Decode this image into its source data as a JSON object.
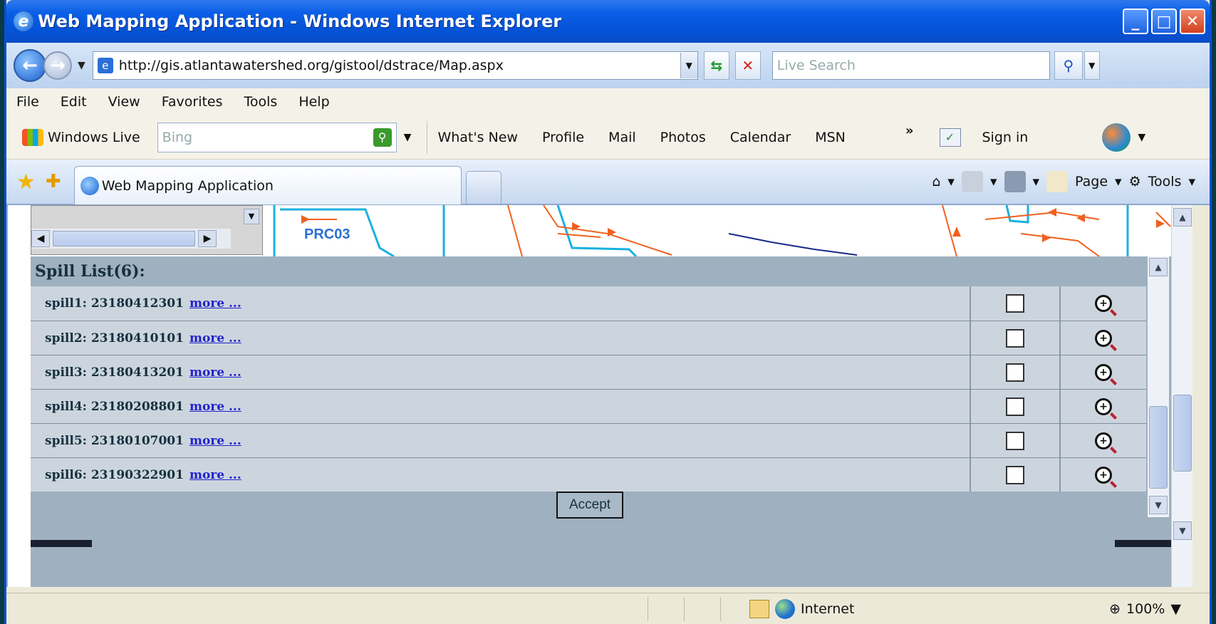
{
  "window": {
    "title": "Web Mapping Application - Windows Internet Explorer"
  },
  "address": {
    "url": "http://gis.atlantawatershed.org/gistool/dstrace/Map.aspx",
    "search_placeholder": "Live Search"
  },
  "menu": [
    "File",
    "Edit",
    "View",
    "Favorites",
    "Tools",
    "Help"
  ],
  "links_toolbar": {
    "brand": "Windows Live",
    "search_placeholder": "Bing",
    "items": [
      "What's New",
      "Profile",
      "Mail",
      "Photos",
      "Calendar",
      "MSN"
    ],
    "sign_in": "Sign in"
  },
  "tabs": {
    "active": "Web Mapping Application"
  },
  "command_bar": {
    "page": "Page",
    "tools": "Tools"
  },
  "map": {
    "label": "PRC03"
  },
  "spill_list": {
    "header": "Spill List(6):",
    "more_label": "more ...",
    "rows": [
      {
        "label": "spill1: 23180412301"
      },
      {
        "label": "spill2: 23180410101"
      },
      {
        "label": "spill3: 23180413201"
      },
      {
        "label": "spill4: 23180208801"
      },
      {
        "label": "spill5: 23180107001"
      },
      {
        "label": "spill6: 23190322901"
      }
    ],
    "accept_label": "Accept"
  },
  "status": {
    "zone": "Internet",
    "zoom": "100%"
  },
  "colors": {
    "title_bar": "#0553d6",
    "panel": "#9fb0c0",
    "link": "#2222cc",
    "map_lines": "#f06020"
  }
}
